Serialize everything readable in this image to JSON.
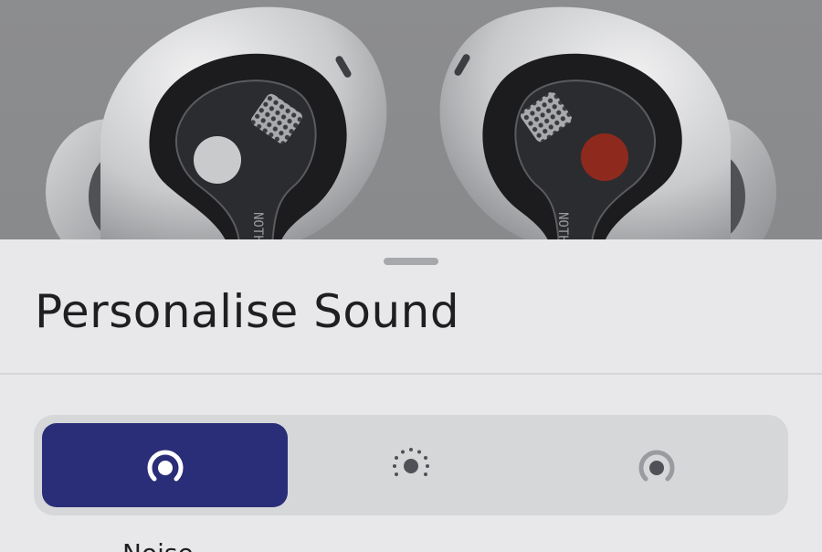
{
  "sheet": {
    "title": "Personalise Sound"
  },
  "noise_control": {
    "selected_index": 0,
    "options": [
      {
        "icon": "noise-cancellation-icon",
        "selected": true
      },
      {
        "icon": "transparency-icon",
        "selected": false
      },
      {
        "icon": "off-icon",
        "selected": false
      }
    ],
    "selected_mode_label": "Noise"
  },
  "colors": {
    "accent": "#2a2d78",
    "sheet_background": "#e8e8ea",
    "segmented_background": "#d6d7d9",
    "right_bud_dot": "#8e2a1d"
  }
}
